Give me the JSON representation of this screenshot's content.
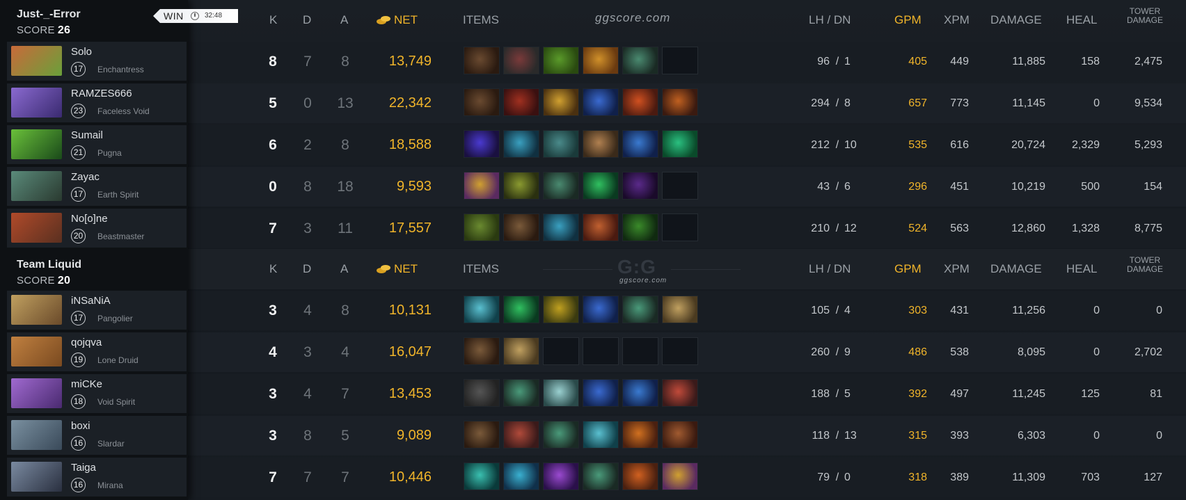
{
  "match": {
    "result": "WIN",
    "duration": "32:48"
  },
  "columns": {
    "k": "K",
    "d": "D",
    "a": "A",
    "net": "NET",
    "items": "ITEMS",
    "lhdn": "LH  /  DN",
    "gpm": "GPM",
    "xpm": "XPM",
    "damage": "DAMAGE",
    "heal": "HEAL",
    "tower_line1": "TOWER",
    "tower_line2": "DAMAGE"
  },
  "watermarks": {
    "top": "ggscore.com",
    "bottom": "G:G",
    "bottom_sub": "ggscore.com"
  },
  "colors": {
    "gold": "#f0b42a",
    "background": "#171c22",
    "sidebar": "#0e1114"
  },
  "teams": [
    {
      "name": "Just-_-Error",
      "score_label": "SCORE",
      "score": "26",
      "players": [
        {
          "name": "Solo",
          "level": "17",
          "hero": "Enchantress",
          "k": "8",
          "d": "7",
          "a": "8",
          "net": "13,749",
          "lh": "96",
          "dn": "1",
          "gpm": "405",
          "xpm": "449",
          "damage": "11,885",
          "heal": "158",
          "tower": "2,475",
          "items": [
            "boots-of-speed",
            "tranquil-boots",
            "ultimate-orb-green",
            "hand-of-midas",
            "magic-wand",
            ""
          ],
          "portrait": [
            "#c86a3a",
            "#6aa03a"
          ]
        },
        {
          "name": "RAMZES666",
          "level": "23",
          "hero": "Faceless Void",
          "k": "5",
          "d": "0",
          "a": "13",
          "net": "22,342",
          "lh": "294",
          "dn": "8",
          "gpm": "657",
          "xpm": "773",
          "damage": "11,145",
          "heal": "0",
          "tower": "9,534",
          "items": [
            "power-treads",
            "black-king-bar",
            "mask-of-madness",
            "butterfly",
            "battle-fury",
            "monkey-king-bar"
          ],
          "portrait": [
            "#8a6ad0",
            "#3a2a70"
          ]
        },
        {
          "name": "Sumail",
          "level": "21",
          "hero": "Pugna",
          "k": "6",
          "d": "2",
          "a": "8",
          "net": "18,588",
          "lh": "212",
          "dn": "10",
          "gpm": "535",
          "xpm": "616",
          "damage": "20,724",
          "heal": "2,329",
          "tower": "5,293",
          "items": [
            "blink-dagger",
            "aether-lens",
            "dagon",
            "pipe",
            "kaya",
            "boots-of-travel"
          ],
          "portrait": [
            "#6ac03a",
            "#1a4a1a"
          ]
        },
        {
          "name": "Zayac",
          "level": "17",
          "hero": "Earth Spirit",
          "k": "0",
          "d": "8",
          "a": "18",
          "net": "9,593",
          "lh": "43",
          "dn": "6",
          "gpm": "296",
          "xpm": "451",
          "damage": "10,219",
          "heal": "500",
          "tower": "154",
          "items": [
            "orb-of-venom",
            "force-staff",
            "ghost-scepter",
            "arcane-boots",
            "magic-stick",
            ""
          ],
          "portrait": [
            "#5a8a7a",
            "#2a3a30"
          ]
        },
        {
          "name": "No[o]ne",
          "level": "20",
          "hero": "Beastmaster",
          "k": "7",
          "d": "3",
          "a": "11",
          "net": "17,557",
          "lh": "210",
          "dn": "12",
          "gpm": "524",
          "xpm": "563",
          "damage": "12,860",
          "heal": "1,328",
          "tower": "8,775",
          "items": [
            "helm-of-dominator",
            "boots",
            "blade-mail",
            "vladmir",
            "necronomicon",
            ""
          ],
          "portrait": [
            "#b04a2a",
            "#5a3020"
          ]
        }
      ]
    },
    {
      "name": "Team Liquid",
      "score_label": "SCORE",
      "score": "20",
      "players": [
        {
          "name": "iNSaNiA",
          "level": "17",
          "hero": "Pangolier",
          "k": "3",
          "d": "4",
          "a": "8",
          "net": "10,131",
          "lh": "105",
          "dn": "4",
          "gpm": "303",
          "xpm": "431",
          "damage": "11,256",
          "heal": "0",
          "tower": "0",
          "items": [
            "blade",
            "arcane-boots",
            "urn",
            "lotus-orb",
            "wand",
            "mekansm"
          ],
          "portrait": [
            "#c0a060",
            "#6a4a2a"
          ]
        },
        {
          "name": "qojqva",
          "level": "19",
          "hero": "Lone Druid",
          "k": "4",
          "d": "3",
          "a": "4",
          "net": "16,047",
          "lh": "260",
          "dn": "9",
          "gpm": "486",
          "xpm": "538",
          "damage": "8,095",
          "heal": "0",
          "tower": "2,702",
          "items": [
            "boots",
            "vanguard",
            "",
            "",
            "",
            ""
          ],
          "portrait": [
            "#c08040",
            "#7a4a20"
          ]
        },
        {
          "name": "miCKe",
          "level": "18",
          "hero": "Void Spirit",
          "k": "3",
          "d": "4",
          "a": "7",
          "net": "13,453",
          "lh": "188",
          "dn": "5",
          "gpm": "392",
          "xpm": "497",
          "damage": "11,245",
          "heal": "125",
          "tower": "81",
          "items": [
            "blink",
            "wand",
            "eul",
            "butterfly",
            "kaya",
            "armor"
          ],
          "portrait": [
            "#a06ad0",
            "#4a2a70"
          ]
        },
        {
          "name": "boxi",
          "level": "16",
          "hero": "Slardar",
          "k": "3",
          "d": "8",
          "a": "5",
          "net": "9,089",
          "lh": "118",
          "dn": "13",
          "gpm": "315",
          "xpm": "393",
          "damage": "6,303",
          "heal": "0",
          "tower": "0",
          "items": [
            "boots",
            "axe",
            "wand",
            "blade",
            "hood",
            "cloak"
          ],
          "portrait": [
            "#7a90a0",
            "#3a4a5a"
          ]
        },
        {
          "name": "Taiga",
          "level": "16",
          "hero": "Mirana",
          "k": "7",
          "d": "7",
          "a": "7",
          "net": "10,446",
          "lh": "79",
          "dn": "0",
          "gpm": "318",
          "xpm": "389",
          "damage": "11,309",
          "heal": "703",
          "tower": "127",
          "items": [
            "tranquil",
            "spirit-vessel",
            "orb",
            "wand",
            "lantern",
            "medallion"
          ],
          "portrait": [
            "#7a8aa0",
            "#2a3040"
          ]
        }
      ]
    }
  ],
  "item_colors": {
    "boots-of-speed": [
      "#6a4a30",
      "#2a1a10"
    ],
    "tranquil-boots": [
      "#7a3a3a",
      "#2a2a2a"
    ],
    "ultimate-orb-green": [
      "#5a9a2a",
      "#2a4a10"
    ],
    "hand-of-midas": [
      "#d0902a",
      "#6a3a10"
    ],
    "magic-wand": [
      "#4a8a70",
      "#1a2a24"
    ],
    "power-treads": [
      "#6a4a30",
      "#2a1a10"
    ],
    "black-king-bar": [
      "#a03020",
      "#3a1010"
    ],
    "mask-of-madness": [
      "#d0a030",
      "#4a3010"
    ],
    "butterfly": [
      "#3a6ad0",
      "#10204a"
    ],
    "battle-fury": [
      "#d05020",
      "#4a1a10"
    ],
    "monkey-king-bar": [
      "#c06020",
      "#3a1a10"
    ],
    "blink-dagger": [
      "#4a3ad0",
      "#1a1040"
    ],
    "aether-lens": [
      "#3aa0c0",
      "#103040"
    ],
    "dagon": [
      "#4a8a8a",
      "#1a3a3a"
    ],
    "pipe": [
      "#b08050",
      "#3a2a1a"
    ],
    "kaya": [
      "#3a7ad0",
      "#10204a"
    ],
    "boots-of-travel": [
      "#2ac080",
      "#0a4a2a"
    ],
    "orb-of-venom": [
      "#d0a030",
      "#5a2a60"
    ],
    "force-staff": [
      "#8a9a30",
      "#2a3010"
    ],
    "ghost-scepter": [
      "#4a8a70",
      "#1a2a24"
    ],
    "arcane-boots": [
      "#30c060",
      "#0a3a20"
    ],
    "magic-stick": [
      "#5a2a8a",
      "#1a0a2a"
    ],
    "helm-of-dominator": [
      "#6a8a30",
      "#2a3a10"
    ],
    "boots": [
      "#7a5a3a",
      "#2a1a10"
    ],
    "blade-mail": [
      "#3aa0c0",
      "#103040"
    ],
    "vladmir": [
      "#c06030",
      "#4a1a10"
    ],
    "necronomicon": [
      "#3a8a2a",
      "#102a10"
    ],
    "blade": [
      "#5ac0d0",
      "#10404a"
    ],
    "urn": [
      "#c0a020",
      "#3a3a10"
    ],
    "lotus-orb": [
      "#3a6ad0",
      "#10204a"
    ],
    "wand": [
      "#4a9a7a",
      "#1a2a24"
    ],
    "mekansm": [
      "#c0a060",
      "#4a3a20"
    ],
    "vanguard": [
      "#c0a060",
      "#4a3a20"
    ],
    "eul": [
      "#9ad0d0",
      "#2a4a4a"
    ],
    "armor": [
      "#c04a3a",
      "#3a1a1a"
    ],
    "axe": [
      "#b04a3a",
      "#3a1a1a"
    ],
    "hood": [
      "#d07020",
      "#4a2010"
    ],
    "cloak": [
      "#a05a30",
      "#3a1a10"
    ],
    "tranquil": [
      "#3ac0b0",
      "#0a3a3a"
    ],
    "spirit-vessel": [
      "#3ab0d0",
      "#10304a"
    ],
    "orb": [
      "#9a4ad0",
      "#2a104a"
    ],
    "lantern": [
      "#d06020",
      "#4a2010"
    ],
    "medallion": [
      "#d0a030",
      "#5a2a60"
    ]
  }
}
